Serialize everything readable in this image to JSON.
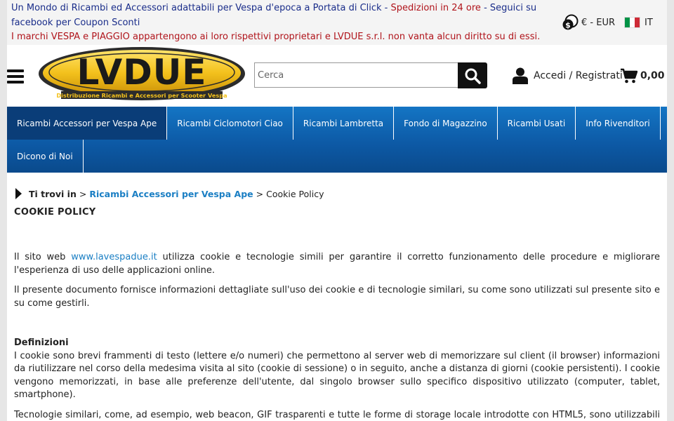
{
  "topbar": {
    "promo_1": "Un Mondo di Ricambi ed Accessori adattabili per Vespa d'epoca a Portata di Click - ",
    "promo_red": "Spedizioni in 24 ore",
    "promo_2": " - Seguici su facebook per Coupon Sconti",
    "disclaimer": "I marchi VESPA e PIAGGIO appartengono ai loro rispettivi proprietari e LVDUE s.r.l. non vanta alcun diritto su di essi.",
    "currency_label": "€ - EUR",
    "currency_icon": "money-coins-icon",
    "language_label": "IT",
    "language_icon": "italy-flag-icon"
  },
  "header": {
    "logo_text": "LVDUE",
    "logo_tagline": "Distribuzione Ricambi e Accessori per Scooter Vespa",
    "search_placeholder": "Cerca",
    "search_icon": "search-icon",
    "login_label": "Accedi / Registrati",
    "cart_total": "0,00",
    "colors": {
      "nav_blue": "#0d5aa6",
      "nav_active": "#0a3d78",
      "link": "#1b7fc4",
      "promo_blue": "#1a2d8a",
      "promo_red": "#b0141b",
      "logo_yellow": "#f3c11c"
    }
  },
  "nav": {
    "row1": [
      {
        "label": "Ricambi Accessori per Vespa Ape",
        "active": true
      },
      {
        "label": "Ricambi Ciclomotori Ciao",
        "active": false
      },
      {
        "label": "Ricambi Lambretta",
        "active": false
      },
      {
        "label": "Fondo di Magazzino",
        "active": false
      },
      {
        "label": "Ricambi Usati",
        "active": false
      },
      {
        "label": "Info Rivenditori",
        "active": false
      }
    ],
    "row2": [
      {
        "label": "Dicono di Noi",
        "active": false
      }
    ]
  },
  "breadcrumb": {
    "prefix": "Ti trovi in",
    "sep": ">",
    "link": "Ricambi Accessori per Vespa Ape",
    "current": "Cookie Policy"
  },
  "content": {
    "title": "COOKIE POLICY",
    "p1_start": "Il sito web ",
    "p1_link": "www.lavespadue.it",
    "p1_end": " utilizza cookie e tecnologie simili per garantire il corretto funzionamento delle procedure e migliorare l'esperienza di uso delle applicazioni online.",
    "p2": "Il presente documento fornisce informazioni dettagliate sull'uso dei cookie e di tecnologie similari, su come sono utilizzati sul presente sito e su come gestirli.",
    "def_title": "Definizioni",
    "p3": "I cookie sono brevi frammenti di testo (lettere e/o numeri) che permettono al server web di memorizzare sul client (il browser) informazioni da riutilizzare nel corso della medesima visita al sito (cookie di sessione) o in seguito, anche a distanza di giorni (cookie persistenti). I cookie vengono memorizzati, in base alle preferenze dell'utente, dal singolo browser sullo specifico dispositivo utilizzato (computer, tablet, smartphone).",
    "p4": "Tecnologie similari, come, ad esempio, web beacon, GIF trasparenti e tutte le forme di storage locale introdotte con HTML5, sono utilizzabili per raccogliere informazioni sul comportamento dell'utente e sull'utilizzo dei servizi. Nel seguito di questo documento faremo riferimento ai"
  }
}
